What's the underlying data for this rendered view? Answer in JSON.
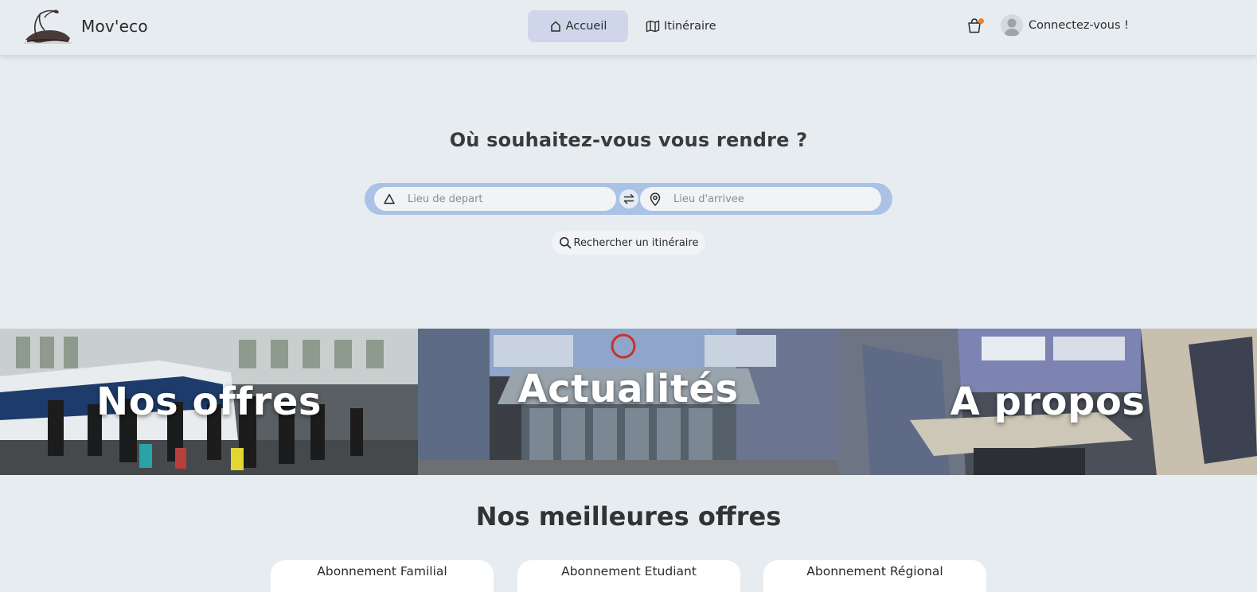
{
  "brand": {
    "name": "Mov'eco",
    "logo_icon": "train-logo-icon"
  },
  "nav": {
    "items": [
      {
        "label": "Accueil",
        "icon": "home-icon",
        "active": true
      },
      {
        "label": "Itinéraire",
        "icon": "map-icon",
        "active": false
      }
    ]
  },
  "header": {
    "basket_icon": "basket-icon",
    "account_label": "Connectez-vous !"
  },
  "hero": {
    "title": "Où souhaitez-vous vous rendre ?",
    "departure_placeholder": "Lieu de depart",
    "arrival_placeholder": "Lieu d'arrivee",
    "departure_value": "",
    "arrival_value": "",
    "search_button": "Rechercher un itinéraire"
  },
  "tiles": [
    {
      "label": "Nos offres"
    },
    {
      "label": "Actualités"
    },
    {
      "label": "A propos"
    }
  ],
  "offers": {
    "title": "Nos meilleures offres",
    "items": [
      {
        "label": "Abonnement Familial"
      },
      {
        "label": "Abonnement Etudiant"
      },
      {
        "label": "Abonnement Régional"
      }
    ]
  },
  "colors": {
    "page_bg": "#e7ecf1",
    "nav_active": "#cfd6ea",
    "search_bar": "#a9c2e6",
    "notification_dot": "#f0812b"
  }
}
